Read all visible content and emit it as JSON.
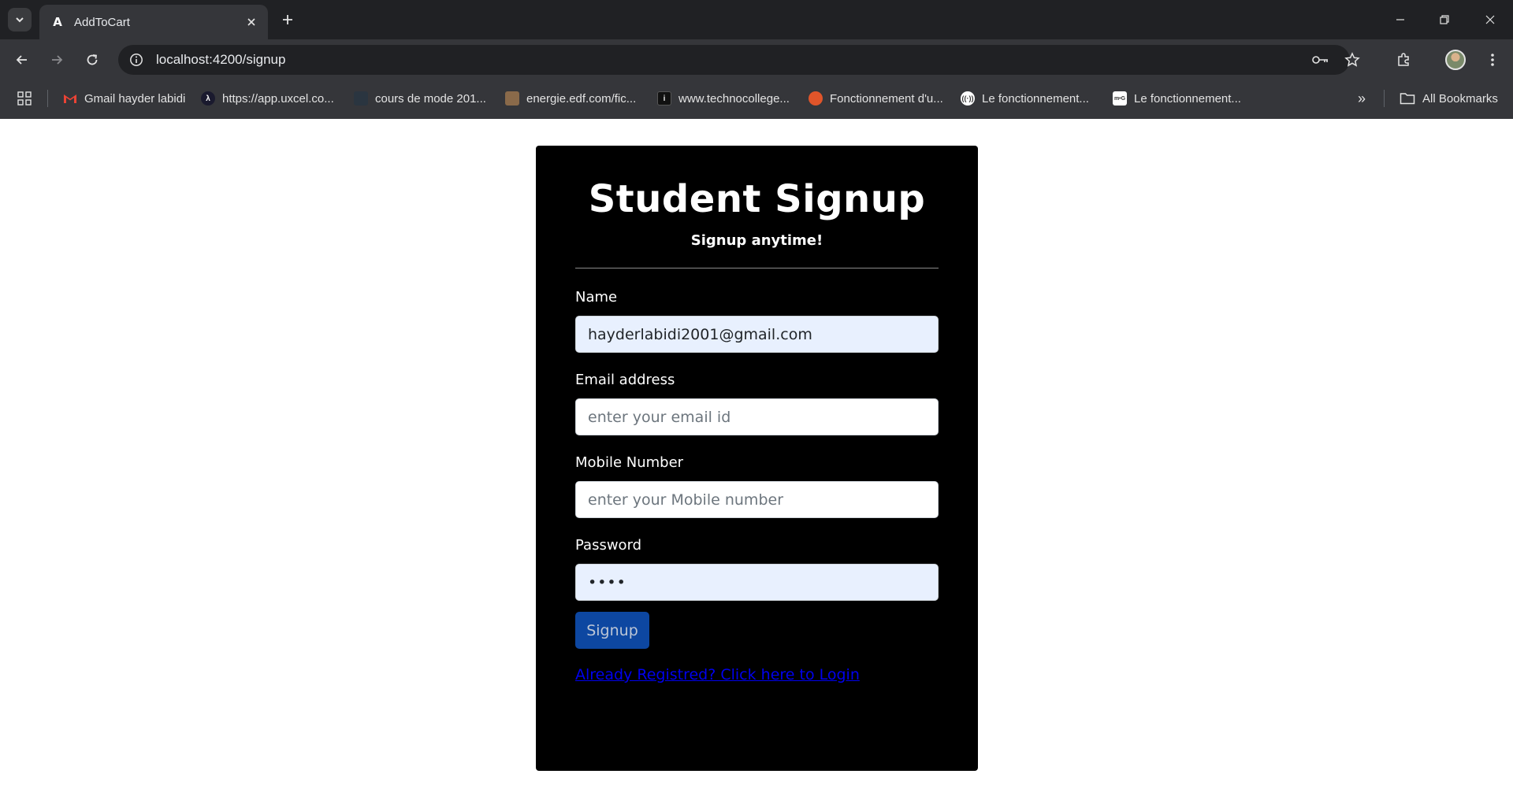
{
  "browser": {
    "tab_title": "AddToCart",
    "url": "localhost:4200/signup",
    "bookmarks": [
      {
        "label": "Gmail hayder labidi",
        "icon": "gmail-icon",
        "color": "#ea4335"
      },
      {
        "label": "https://app.uxcel.co...",
        "icon": "uxcel-icon",
        "color": "#1a1a2e"
      },
      {
        "label": "cours de mode 201...",
        "icon": "generic-site-icon",
        "color": "#2a3540"
      },
      {
        "label": "energie.edf.com/fic...",
        "icon": "edf-icon",
        "color": "#8a6a4a"
      },
      {
        "label": "www.technocollege...",
        "icon": "technocollege-icon",
        "color": "#111111"
      },
      {
        "label": "Fonctionnement d'u...",
        "icon": "orange-site-icon",
        "color": "#e0552a"
      },
      {
        "label": "Le fonctionnement...",
        "icon": "radio-site-icon",
        "color": "#ffffff"
      },
      {
        "label": "Le fonctionnement...",
        "icon": "mg-site-icon",
        "color": "#ffffff"
      }
    ],
    "all_bookmarks_label": "All Bookmarks"
  },
  "form": {
    "title": "Student Signup",
    "subtitle": "Signup anytime!",
    "name_label": "Name",
    "name_value": "hayderlabidi2001@gmail.com",
    "email_label": "Email address",
    "email_placeholder": "enter your email id",
    "mobile_label": "Mobile Number",
    "mobile_placeholder": "enter your Mobile number",
    "password_label": "Password",
    "password_value": "••••",
    "submit_label": "Signup",
    "login_link": "Already Registred? Click here to Login"
  },
  "colors": {
    "card_bg": "#000000",
    "autofill_bg": "#e8f0fe",
    "button_bg": "#0d47a1",
    "link": "#0000ee"
  }
}
